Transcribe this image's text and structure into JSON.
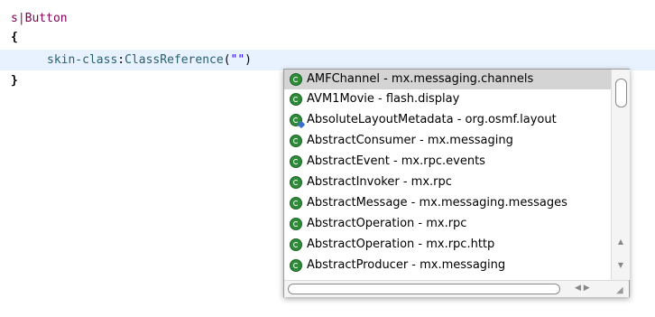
{
  "code": {
    "selector": "s|Button",
    "open_brace": "{",
    "close_brace": "}",
    "property": "skin-class",
    "colon": ":",
    "function": "ClassReference",
    "paren_open": "(",
    "string": "\"\"",
    "paren_close": ")"
  },
  "autocomplete": {
    "items": [
      {
        "label": "AMFChannel - mx.messaging.channels",
        "icon": "class-icon",
        "selected": true
      },
      {
        "label": "AVM1Movie - flash.display",
        "icon": "class-icon",
        "selected": false
      },
      {
        "label": "AbsoluteLayoutMetadata - org.osmf.layout",
        "icon": "class-icon-alt",
        "selected": false
      },
      {
        "label": "AbstractConsumer - mx.messaging",
        "icon": "class-icon",
        "selected": false
      },
      {
        "label": "AbstractEvent - mx.rpc.events",
        "icon": "class-icon",
        "selected": false
      },
      {
        "label": "AbstractInvoker - mx.rpc",
        "icon": "class-icon",
        "selected": false
      },
      {
        "label": "AbstractMessage - mx.messaging.messages",
        "icon": "class-icon",
        "selected": false
      },
      {
        "label": "AbstractOperation - mx.rpc",
        "icon": "class-icon",
        "selected": false
      },
      {
        "label": "AbstractOperation - mx.rpc.http",
        "icon": "class-icon",
        "selected": false
      },
      {
        "label": "AbstractProducer - mx.messaging",
        "icon": "class-icon",
        "selected": false
      }
    ]
  },
  "icons": {
    "scroll_up": "▲",
    "scroll_down": "▼",
    "scroll_left": "◀",
    "scroll_right": "▶",
    "resize_grip": "◢"
  },
  "colors": {
    "selection": "#d4d4d4",
    "current_line": "#e8f2fe",
    "class_icon": "#2f8a3a"
  }
}
